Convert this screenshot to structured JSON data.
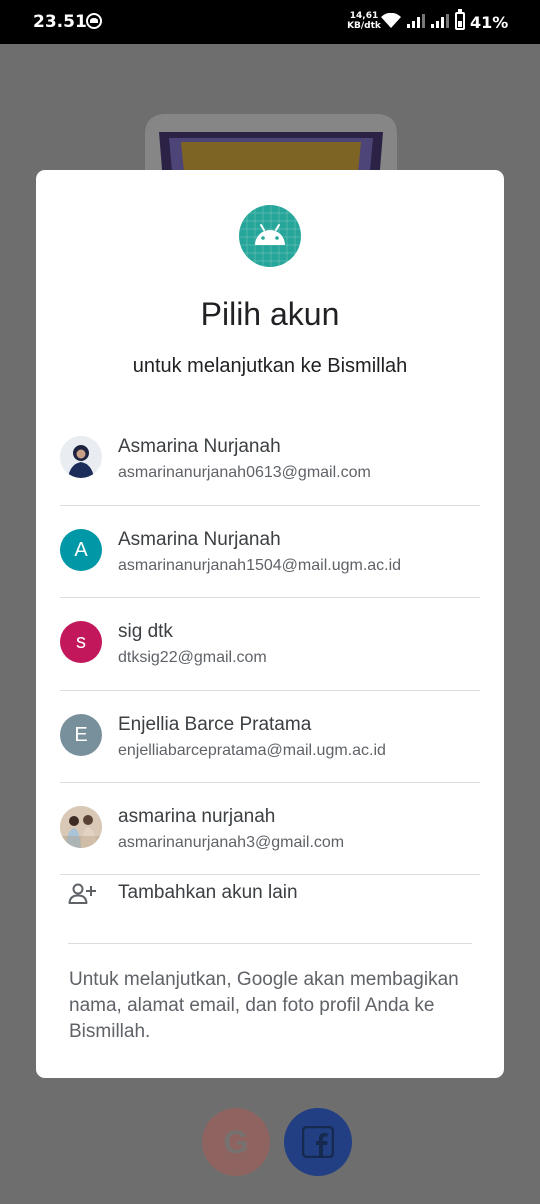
{
  "status_bar": {
    "time": "23.51",
    "speed_value": "14,61",
    "speed_unit": "KB/dtk",
    "battery": "41%",
    "icons": [
      "notification-icon",
      "wifi-icon",
      "signal-icon",
      "signal-icon",
      "battery-icon"
    ]
  },
  "background": {
    "icons": [
      "app-logo-icon",
      "google-icon",
      "facebook-icon"
    ],
    "google_letter": "G"
  },
  "dialog": {
    "app_icon": "android-icon",
    "title": "Pilih akun",
    "subtitle": "untuk melanjutkan ke Bismillah",
    "accounts": [
      {
        "name": "Asmarina Nurjanah",
        "email": "asmarinanurjanah0613@gmail.com",
        "avatar_type": "photo",
        "avatar_icon": "profile-photo"
      },
      {
        "name": "Asmarina Nurjanah",
        "email": "asmarinanurjanah1504@mail.ugm.ac.id",
        "avatar_type": "letter",
        "avatar_letter": "A",
        "avatar_color": "#0097a7"
      },
      {
        "name": "sig dtk",
        "email": "dtksig22@gmail.com",
        "avatar_type": "letter",
        "avatar_letter": "s",
        "avatar_color": "#c2185b"
      },
      {
        "name": "Enjellia Barce Pratama",
        "email": "enjelliabarcepratama@mail.ugm.ac.id",
        "avatar_type": "letter",
        "avatar_letter": "E",
        "avatar_color": "#78909c"
      },
      {
        "name": "asmarina nurjanah",
        "email": "asmarinanurjanah3@gmail.com",
        "avatar_type": "photo",
        "avatar_icon": "profile-photo"
      }
    ],
    "add_account_icon": "add-person-icon",
    "add_account_label": "Tambahkan akun lain",
    "footer": "Untuk melanjutkan, Google akan membagikan nama, alamat email, dan foto profil Anda ke Bismillah."
  },
  "colors": {
    "scrim": "#6e6e6e",
    "text_primary": "#202124",
    "text_secondary": "#5f6368",
    "android_green": "#26a69a"
  }
}
